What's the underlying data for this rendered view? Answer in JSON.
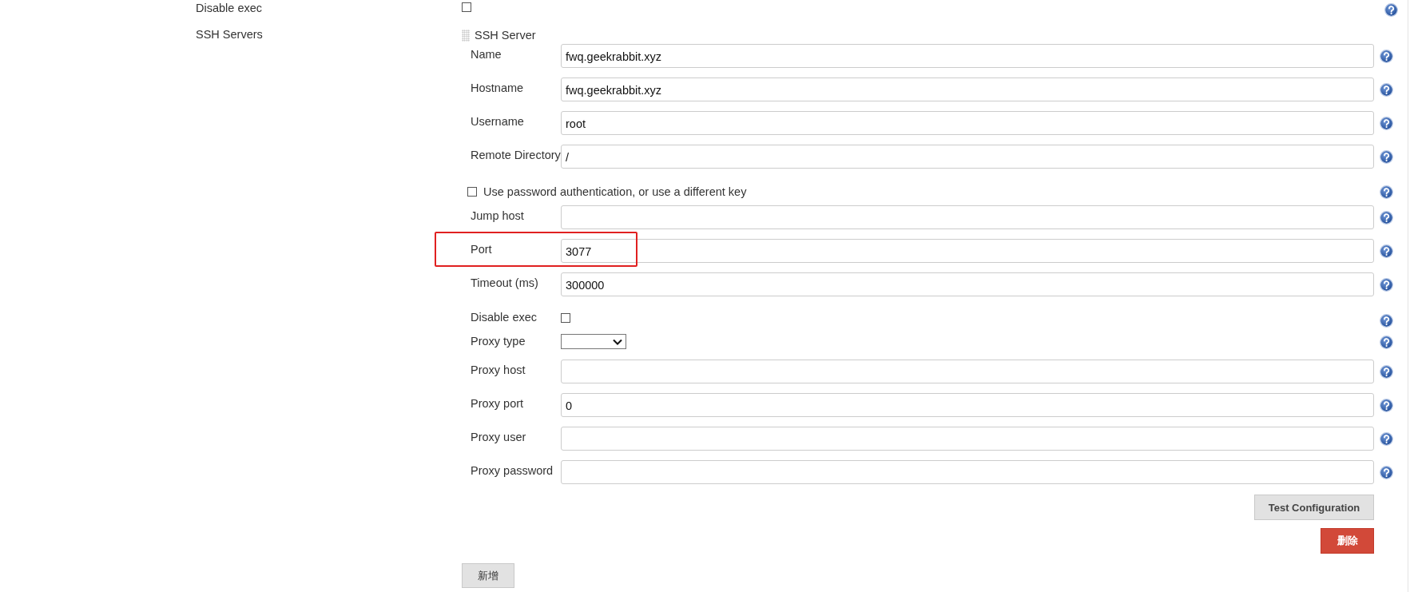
{
  "top_fields": [
    {
      "kind": "checkbox",
      "label": "Disable exec",
      "checked": false
    }
  ],
  "ssh_servers": {
    "label": "SSH Servers",
    "server": {
      "title": "SSH Server",
      "fields": [
        {
          "kind": "text",
          "label": "Name",
          "value": "fwq.geekrabbit.xyz",
          "highlight": false
        },
        {
          "kind": "text",
          "label": "Hostname",
          "value": "fwq.geekrabbit.xyz",
          "highlight": false
        },
        {
          "kind": "text",
          "label": "Username",
          "value": "root",
          "highlight": false
        },
        {
          "kind": "text",
          "label": "Remote Directory",
          "value": "/",
          "highlight": false
        },
        {
          "kind": "inline-checkbox",
          "label": "Use password authentication, or use a different key",
          "checked": false
        },
        {
          "kind": "text",
          "label": "Jump host",
          "highlight": false
        },
        {
          "kind": "text",
          "label": "Port",
          "value": "3077",
          "highlight": true
        },
        {
          "kind": "text",
          "label": "Timeout (ms)",
          "value": "300000",
          "highlight": false
        },
        {
          "kind": "checkbox",
          "label": "Disable exec",
          "checked": false
        },
        {
          "kind": "select",
          "label": "Proxy type"
        },
        {
          "kind": "text",
          "label": "Proxy host",
          "highlight": false
        },
        {
          "kind": "text",
          "label": "Proxy port",
          "value": "0",
          "highlight": false
        },
        {
          "kind": "text",
          "label": "Proxy user",
          "highlight": false
        },
        {
          "kind": "text",
          "label": "Proxy password",
          "highlight": false
        }
      ],
      "test_button": "Test Configuration",
      "delete_button": "删除"
    },
    "add_button": "新增"
  }
}
